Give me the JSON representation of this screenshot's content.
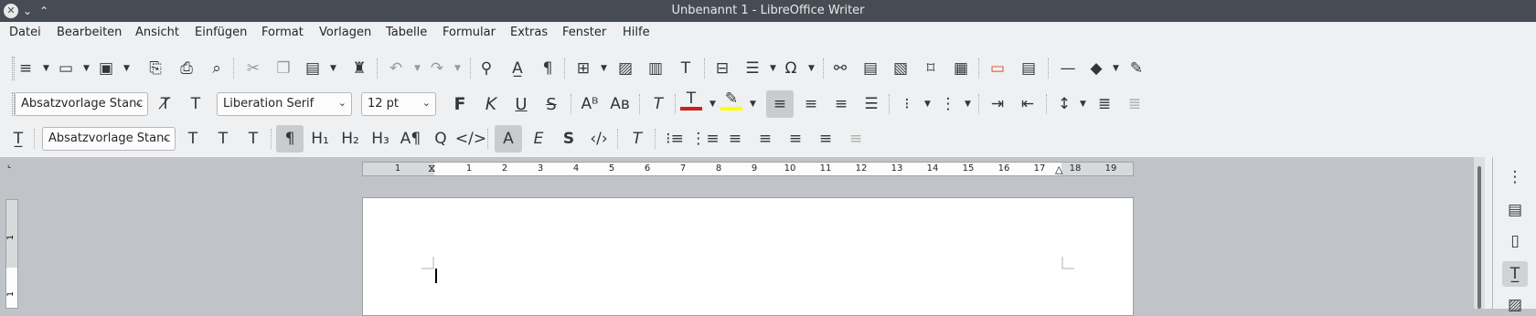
{
  "window": {
    "title": "Unbenannt 1 - LibreOffice Writer"
  },
  "menu": [
    "Datei",
    "Bearbeiten",
    "Ansicht",
    "Einfügen",
    "Format",
    "Vorlagen",
    "Tabelle",
    "Formular",
    "Extras",
    "Fenster",
    "Hilfe"
  ],
  "formatting": {
    "paragraph_style": "Absatzvorlage Stanc",
    "font_name": "Liberation Serif",
    "font_size": "12 pt"
  },
  "sidebar_toolbar": {
    "paragraph_style": "Absatzvorlage Stanc"
  },
  "ruler": {
    "numbers": [
      "1",
      "1",
      "2",
      "3",
      "4",
      "5",
      "6",
      "7",
      "8",
      "9",
      "10",
      "11",
      "12",
      "13",
      "14",
      "15",
      "16",
      "17",
      "18",
      "19"
    ],
    "vertical_numbers": [
      "1",
      "1"
    ]
  },
  "colors": {
    "font_color": "#c9211e",
    "highlight_color": "#ffff00"
  },
  "icons": {
    "new": "new-document-icon",
    "open": "open-icon",
    "save": "save-icon",
    "export_pdf": "export-pdf-icon",
    "print": "print-icon",
    "print_preview": "print-preview-icon",
    "cut": "cut-icon",
    "copy": "copy-icon",
    "paste": "paste-icon",
    "clone": "clone-formatting-icon",
    "undo": "undo-icon",
    "redo": "redo-icon",
    "find": "find-replace-icon",
    "spelling": "spelling-icon",
    "formatting_marks": "formatting-marks-icon",
    "table": "insert-table-icon",
    "image": "insert-image-icon",
    "chart": "insert-chart-icon",
    "textbox": "insert-textbox-icon",
    "page_break": "page-break-icon",
    "field": "insert-field-icon",
    "special_char": "special-character-icon",
    "hyperlink": "hyperlink-icon",
    "footnote": "footnote-icon",
    "endnote": "endnote-icon",
    "bookmark": "bookmark-icon",
    "cross_ref": "cross-reference-icon",
    "comment": "comment-icon",
    "track_changes": "track-changes-icon",
    "line": "line-icon",
    "shapes": "basic-shapes-icon",
    "draw": "draw-icon"
  }
}
